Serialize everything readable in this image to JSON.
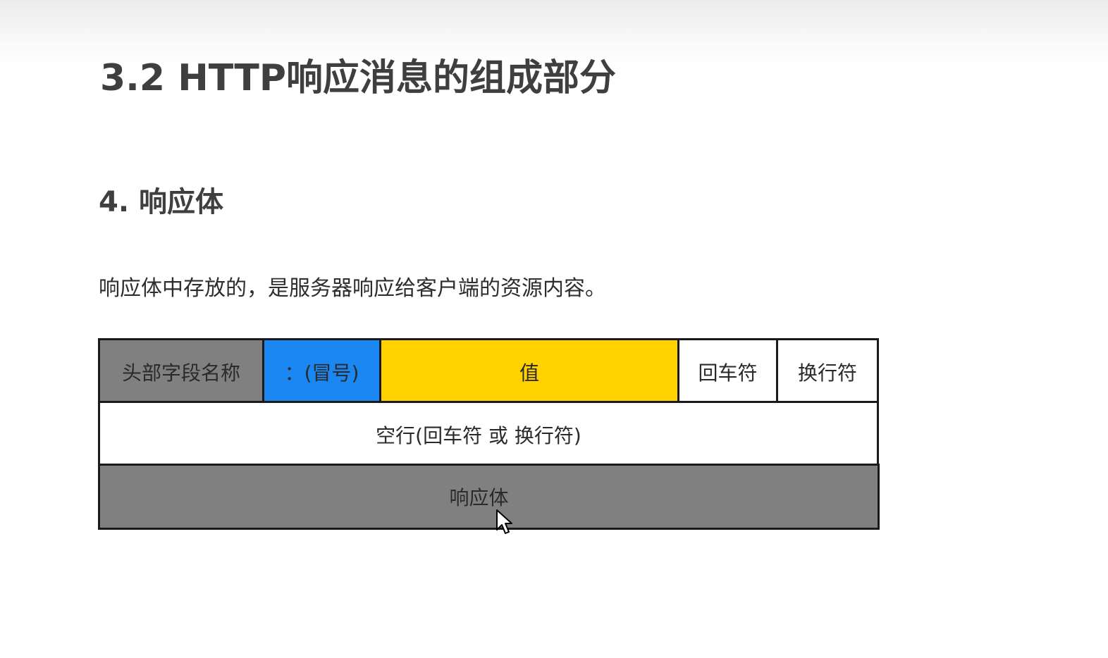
{
  "heading": {
    "title": "3.2 HTTP响应消息的组成部分",
    "section": "4. 响应体"
  },
  "description": "响应体中存放的，是服务器响应给客户端的资源内容。",
  "diagram": {
    "row1": {
      "header_name": "头部字段名称",
      "colon": "：(冒号)",
      "value": "值",
      "carriage_return": "回车符",
      "line_feed": "换行符"
    },
    "row2": {
      "blank_line": "空行(回车符 或 换行符)"
    },
    "row3": {
      "body": "响应体"
    },
    "colors": {
      "gray": "#808080",
      "blue": "#1a87f2",
      "yellow": "#ffd200",
      "white": "#ffffff"
    }
  },
  "icons": {
    "cursor": "mouse-pointer-icon"
  }
}
